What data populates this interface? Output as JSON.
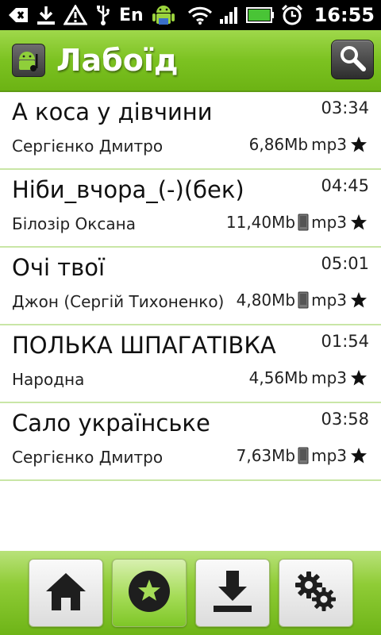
{
  "status_bar": {
    "language": "En",
    "time": "16:55",
    "icons": [
      "back-arrow-icon",
      "download-icon",
      "warning-icon",
      "usb-icon",
      "android-icon",
      "wifi-icon",
      "signal-icon",
      "battery-icon",
      "alarm-icon"
    ]
  },
  "header": {
    "title": "Лабоїд",
    "app_icon": "android-music-icon",
    "search_icon": "search-icon"
  },
  "tracks": [
    {
      "title": "А коса у дівчини",
      "duration": "03:34",
      "artist": "Сергієнко Дмитро",
      "size": "6,86Mb",
      "format": "mp3",
      "on_device": false
    },
    {
      "title": "Ніби_вчора_(-)(бек)",
      "duration": "04:45",
      "artist": "Білозір Оксана",
      "size": "11,40Mb",
      "format": "mp3",
      "on_device": true
    },
    {
      "title": "Очі твої",
      "duration": "05:01",
      "artist": "Джон (Сергій Тихоненко)",
      "size": "4,80Mb",
      "format": "mp3",
      "on_device": true
    },
    {
      "title": "ПОЛЬКА ШПАГАТІВКА",
      "duration": "01:54",
      "artist": "Народна",
      "size": "4,56Mb",
      "format": "mp3",
      "on_device": false
    },
    {
      "title": "Сало українське",
      "duration": "03:58",
      "artist": "Сергієнко Дмитро",
      "size": "7,63Mb",
      "format": "mp3",
      "on_device": true
    }
  ],
  "toolbar": {
    "buttons": [
      "home-icon",
      "favorites-icon",
      "download-icon",
      "settings-gears-icon"
    ],
    "active": 1
  },
  "colors": {
    "accent_green": "#7cc221",
    "divider": "#c9e6a6",
    "status_bar": "#000000"
  }
}
